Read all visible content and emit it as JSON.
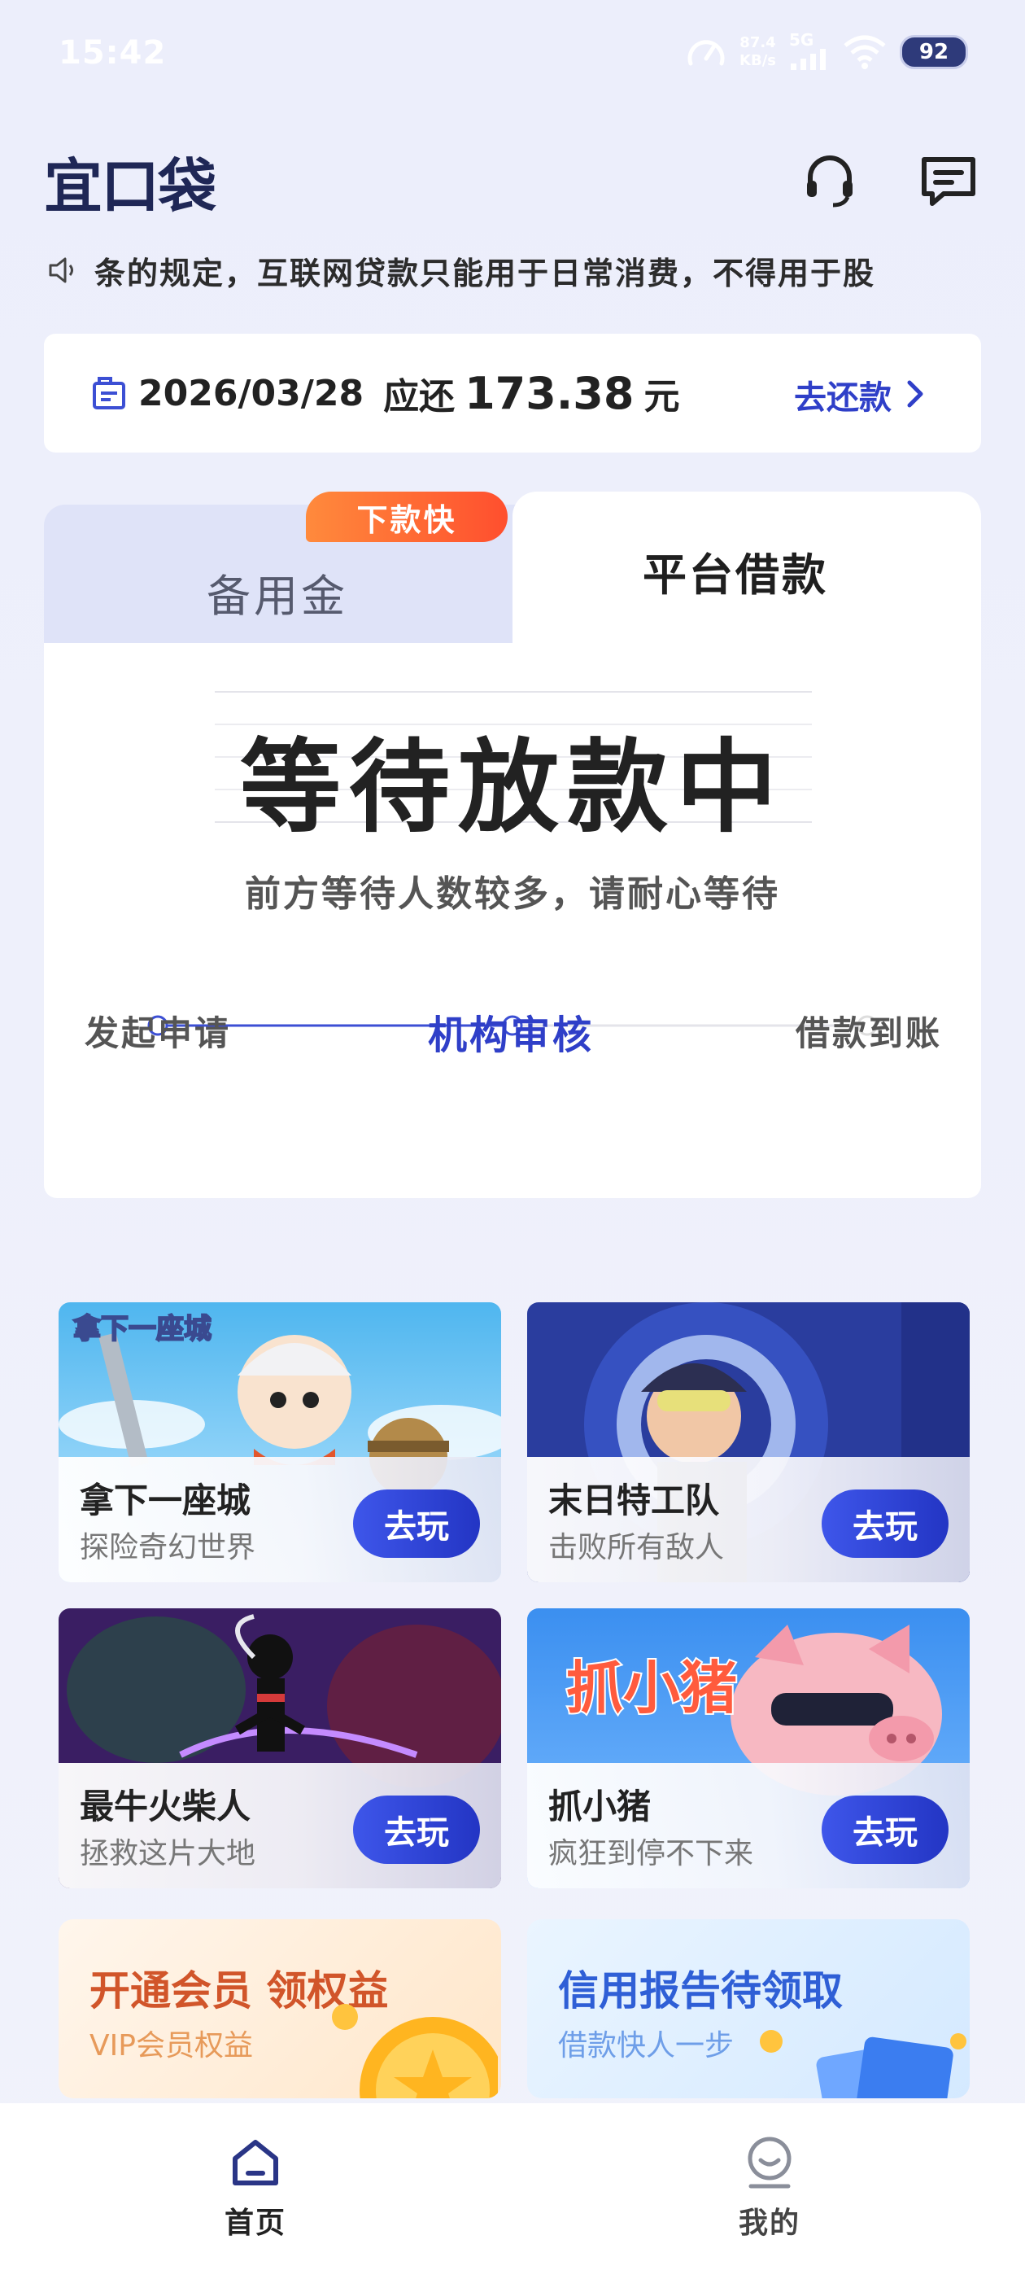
{
  "status_bar": {
    "time": "15:42",
    "net_speed": "87.4",
    "net_unit": "KB/s",
    "signal": "5G",
    "battery": "92"
  },
  "header": {
    "logo": "宜口袋",
    "icons": [
      "headset-icon",
      "message-icon"
    ]
  },
  "notice": {
    "icon": "speaker-icon",
    "text": "条的规定，互联网贷款只能用于日常消费，不得用于股"
  },
  "repay": {
    "date": "2026/03/28",
    "due_label": "应还",
    "amount": "173.38",
    "unit": "元",
    "action": "去还款"
  },
  "loan_card": {
    "tabs": [
      {
        "label": "备用金",
        "badge": "下款快"
      },
      {
        "label": "平台借款"
      }
    ],
    "active_tab": 1,
    "status_title": "等待放款中",
    "status_sub": "前方等待人数较多，请耐心等待",
    "steps": [
      {
        "label": "发起申请"
      },
      {
        "label": "机构审核"
      },
      {
        "label": "借款到账"
      }
    ],
    "current_step": 1,
    "accent": "#2f3fc8"
  },
  "games": [
    {
      "art_text": "拿下一座城",
      "name": "拿下一座城",
      "desc": "探险奇幻世界",
      "action": "去玩"
    },
    {
      "name": "末日特工队",
      "desc": "击败所有敌人",
      "action": "去玩"
    },
    {
      "name": "最牛火柴人",
      "desc": "拯救这片大地",
      "action": "去玩"
    },
    {
      "art_text": "抓小猪",
      "name": "抓小猪",
      "desc": "疯狂到停不下来",
      "action": "去玩"
    }
  ],
  "promos": [
    {
      "title": "开通会员 领权益",
      "sub": "VIP会员权益"
    },
    {
      "title": "信用报告待领取",
      "sub": "借款快人一步"
    }
  ],
  "nav": {
    "items": [
      {
        "label": "首页",
        "icon": "home-icon",
        "active": true
      },
      {
        "label": "我的",
        "icon": "profile-icon",
        "active": false
      }
    ]
  }
}
